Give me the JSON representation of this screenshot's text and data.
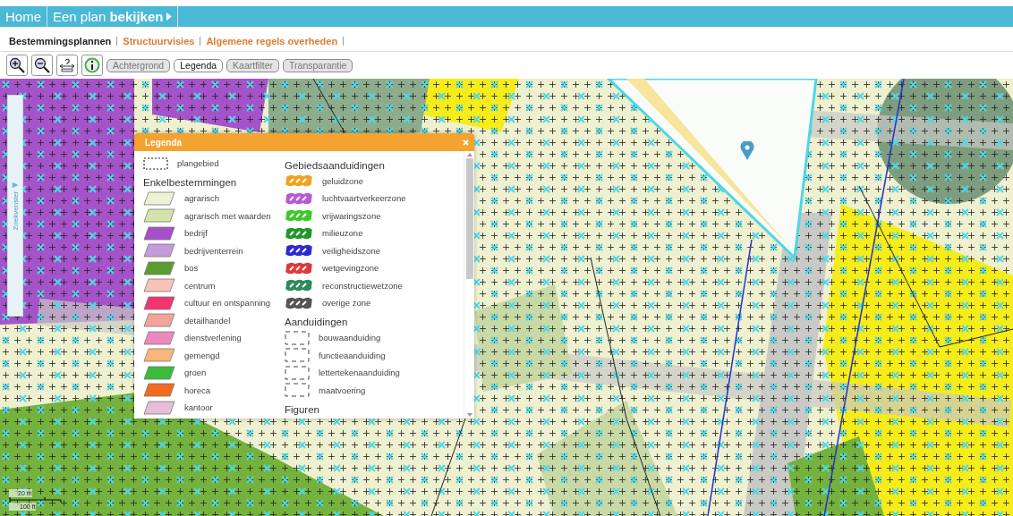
{
  "breadcrumbs": [
    {
      "label": "Home"
    },
    {
      "label": "Een plan **bekijken**"
    }
  ],
  "tabs": [
    {
      "label": "Bestemmingsplannen",
      "selected": true
    },
    {
      "label": "Structuurvisies",
      "selected": false
    },
    {
      "label": "Algemene regels overheden",
      "selected": false
    }
  ],
  "toolbar": {
    "tools": [
      {
        "kind": "zoom-in"
      },
      {
        "kind": "zoom-out"
      },
      {
        "kind": "identify"
      },
      {
        "kind": "info"
      }
    ],
    "buttons": [
      {
        "label": "Achtergrond",
        "selected": false
      },
      {
        "label": "Legenda",
        "selected": true
      },
      {
        "label": "Kaartfilter",
        "selected": false
      },
      {
        "label": "Transparantie",
        "selected": false
      }
    ]
  },
  "side_panel": {
    "label": "Zoekvenster"
  },
  "legend": {
    "title": "Legenda",
    "columns": [
      [
        {
          "kind": "boundary",
          "label": "plangebied"
        },
        {
          "kind": "heading",
          "label": "Enkelbestemmingen"
        },
        {
          "kind": "area",
          "label": "agrarisch",
          "color": "#eef2d4"
        },
        {
          "kind": "area",
          "label": "agrarisch met waarden",
          "color": "#d3e3a8"
        },
        {
          "kind": "area",
          "label": "bedrijf",
          "color": "#a64fc9"
        },
        {
          "kind": "area",
          "label": "bedrijventerrein",
          "color": "#c49cd8"
        },
        {
          "kind": "area",
          "label": "bos",
          "color": "#5a9e2f"
        },
        {
          "kind": "area",
          "label": "centrum",
          "color": "#f7c3bb"
        },
        {
          "kind": "area",
          "label": "cultuur en ontspanning",
          "color": "#f3346e"
        },
        {
          "kind": "area",
          "label": "detailhandel",
          "color": "#f4a39a"
        },
        {
          "kind": "area",
          "label": "dienstverlening",
          "color": "#ec88bd"
        },
        {
          "kind": "area",
          "label": "gemengd",
          "color": "#f8b57c"
        },
        {
          "kind": "area",
          "label": "groen",
          "color": "#3dbb3c"
        },
        {
          "kind": "area",
          "label": "horeca",
          "color": "#f06a1f"
        },
        {
          "kind": "area",
          "label": "kantoor",
          "color": "#e8bdd6"
        }
      ],
      [
        {
          "kind": "heading",
          "label": "Gebiedsaanduidingen"
        },
        {
          "kind": "zone",
          "label": "geluidzone",
          "color": "#f0a321"
        },
        {
          "kind": "zone",
          "label": "luchtvaartverkeerzone",
          "color": "#b65bd6"
        },
        {
          "kind": "zone",
          "label": "vrijwaringszone",
          "color": "#3ec92c"
        },
        {
          "kind": "zone",
          "label": "milieuzone",
          "color": "#23962c"
        },
        {
          "kind": "zone",
          "label": "veiligheidszone",
          "color": "#2d2bd0"
        },
        {
          "kind": "zone",
          "label": "wetgevingzone",
          "color": "#e0383c"
        },
        {
          "kind": "zone",
          "label": "reconstructiewetzone",
          "color": "#2e8a5f"
        },
        {
          "kind": "zone",
          "label": "overige zone",
          "color": "#555555"
        },
        {
          "kind": "heading",
          "label": "Aanduidingen"
        },
        {
          "kind": "dashed",
          "label": "bouwaanduiding"
        },
        {
          "kind": "dashed",
          "label": "functieaanduiding"
        },
        {
          "kind": "dashed",
          "label": "lettertekenaanduiding"
        },
        {
          "kind": "dashed",
          "label": "maatvoering"
        },
        {
          "kind": "heading",
          "label": "Figuren"
        }
      ]
    ]
  },
  "scale_bar": {
    "metric": "20 m",
    "imperial": "100 ft"
  }
}
